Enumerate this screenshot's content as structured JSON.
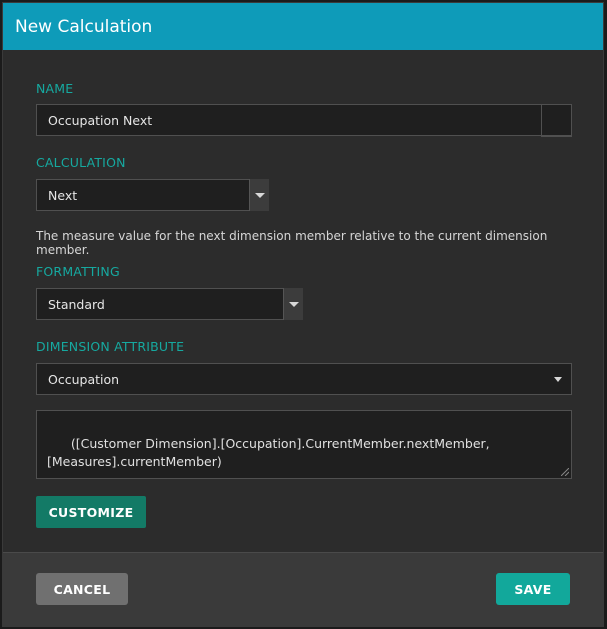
{
  "dialog": {
    "title": "New Calculation"
  },
  "name": {
    "label": "NAME",
    "value": "Occupation Next"
  },
  "calculation": {
    "label": "CALCULATION",
    "selected": "Next",
    "description": "The measure value for the next dimension member relative to the current dimension member."
  },
  "formatting": {
    "label": "FORMATTING",
    "selected": "Standard"
  },
  "dimension_attribute": {
    "label": "DIMENSION ATTRIBUTE",
    "selected": "Occupation",
    "expression": "([Customer Dimension].[Occupation].CurrentMember.nextMember,\n[Measures].currentMember)"
  },
  "buttons": {
    "customize": "CUSTOMIZE",
    "cancel": "CANCEL",
    "save": "SAVE"
  },
  "colors": {
    "titlebar": "#0e9bb9",
    "label_accent": "#16a9a0",
    "customize_bg": "#137a66",
    "save_bg": "#12a89b",
    "cancel_bg": "#707070"
  }
}
